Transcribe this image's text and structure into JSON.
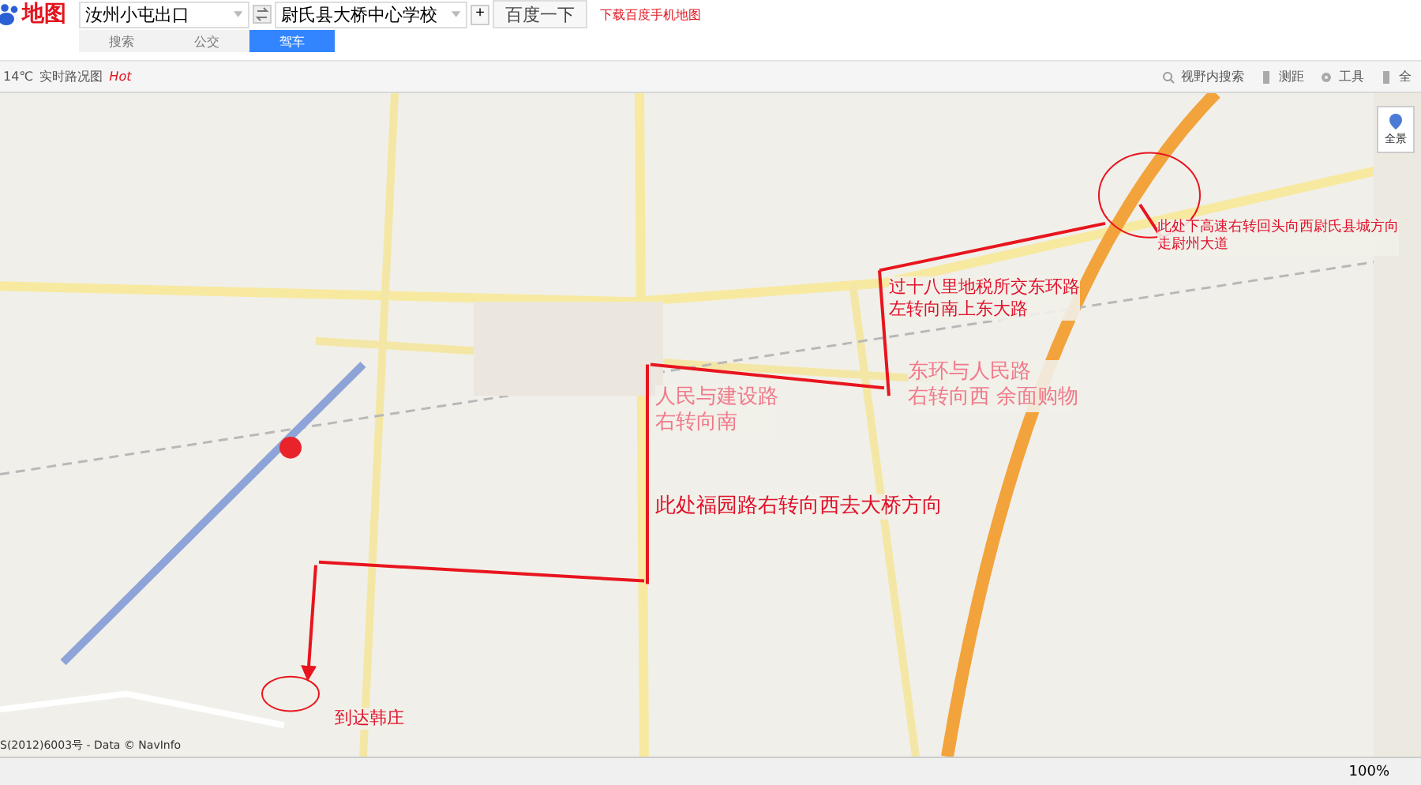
{
  "header": {
    "logo": "地图",
    "origin": {
      "value": "汝州小屯出口"
    },
    "destination": {
      "value": "尉氏县大桥中心学校"
    },
    "add_button": "+",
    "search_button": "百度一下",
    "promo_link": "下载百度手机地图"
  },
  "mode_tabs": [
    {
      "label": "搜索",
      "selected": false
    },
    {
      "label": "公交",
      "selected": false
    },
    {
      "label": "驾车",
      "selected": true
    }
  ],
  "toolbar": {
    "weather": "14℃",
    "traffic": "实时路况图",
    "hot": "Hot",
    "tools": [
      "视野内搜索",
      "测距",
      "工具",
      "全"
    ]
  },
  "map": {
    "kind": "picture",
    "panorama_button": "全景",
    "copyright": "S(2012)6003号 - Data © NavInfo",
    "annotations": [
      {
        "lines": [
          "此处下高速右转回头向西尉氏县城方向",
          "走尉州大道"
        ],
        "color": "#e0102a"
      },
      {
        "lines": [
          "过十八里地税所交东环路",
          "左转向南上东大路"
        ],
        "color": "#e0102a"
      },
      {
        "lines": [
          "东环与人民路",
          "右转向西  余面购物"
        ],
        "color": "#f07a8a"
      },
      {
        "lines": [
          "人民与建设路",
          "右转向南"
        ],
        "color": "#f07a8a"
      },
      {
        "lines": [
          "此处福园路右转向西去大桥方向"
        ],
        "color": "#e0102a"
      },
      {
        "lines": [
          "到达韩庄"
        ],
        "color": "#e0102a"
      }
    ]
  },
  "status_bar": {
    "zoom": "100%"
  }
}
